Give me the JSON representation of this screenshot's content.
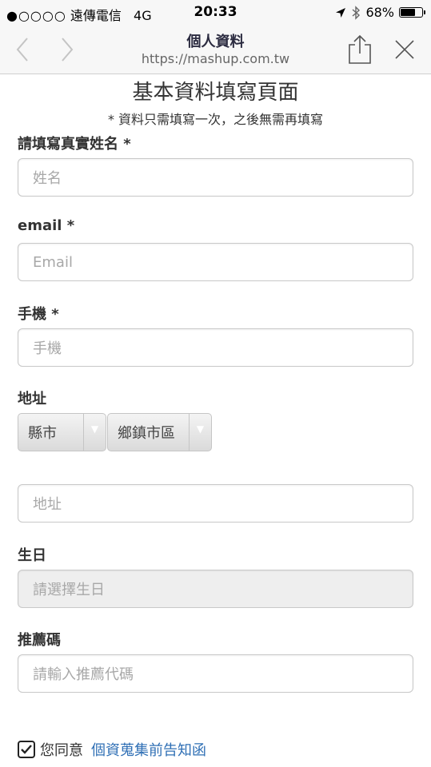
{
  "status_bar": {
    "carrier": "遠傳電信",
    "network": "4G",
    "time": "20:33",
    "battery": "68%",
    "battery_level": 0.68
  },
  "nav": {
    "title": "個人資料",
    "url": "https://mashup.com.tw"
  },
  "form": {
    "title": "基本資料填寫頁面",
    "note": "* 資料只需填寫一次，之後無需再填寫",
    "name_label": "請填寫真實姓名 *",
    "name_placeholder": "姓名",
    "email_label": "email *",
    "email_placeholder": "Email",
    "phone_label": "手機 *",
    "phone_placeholder": "手機",
    "address_label": "地址",
    "city_select": "縣市",
    "district_select": "鄉鎮市區",
    "address_placeholder": "地址",
    "birthday_label": "生日",
    "birthday_placeholder": "請選擇生日",
    "referral_label": "推薦碼",
    "referral_placeholder": "請輸入推薦代碼",
    "agree_text": "您同意",
    "agree_link": "個資蒐集前告知函",
    "agree_checked": true
  },
  "colors": {
    "link": "#2f6fb5",
    "bar_bg": "#f7f7f7"
  }
}
